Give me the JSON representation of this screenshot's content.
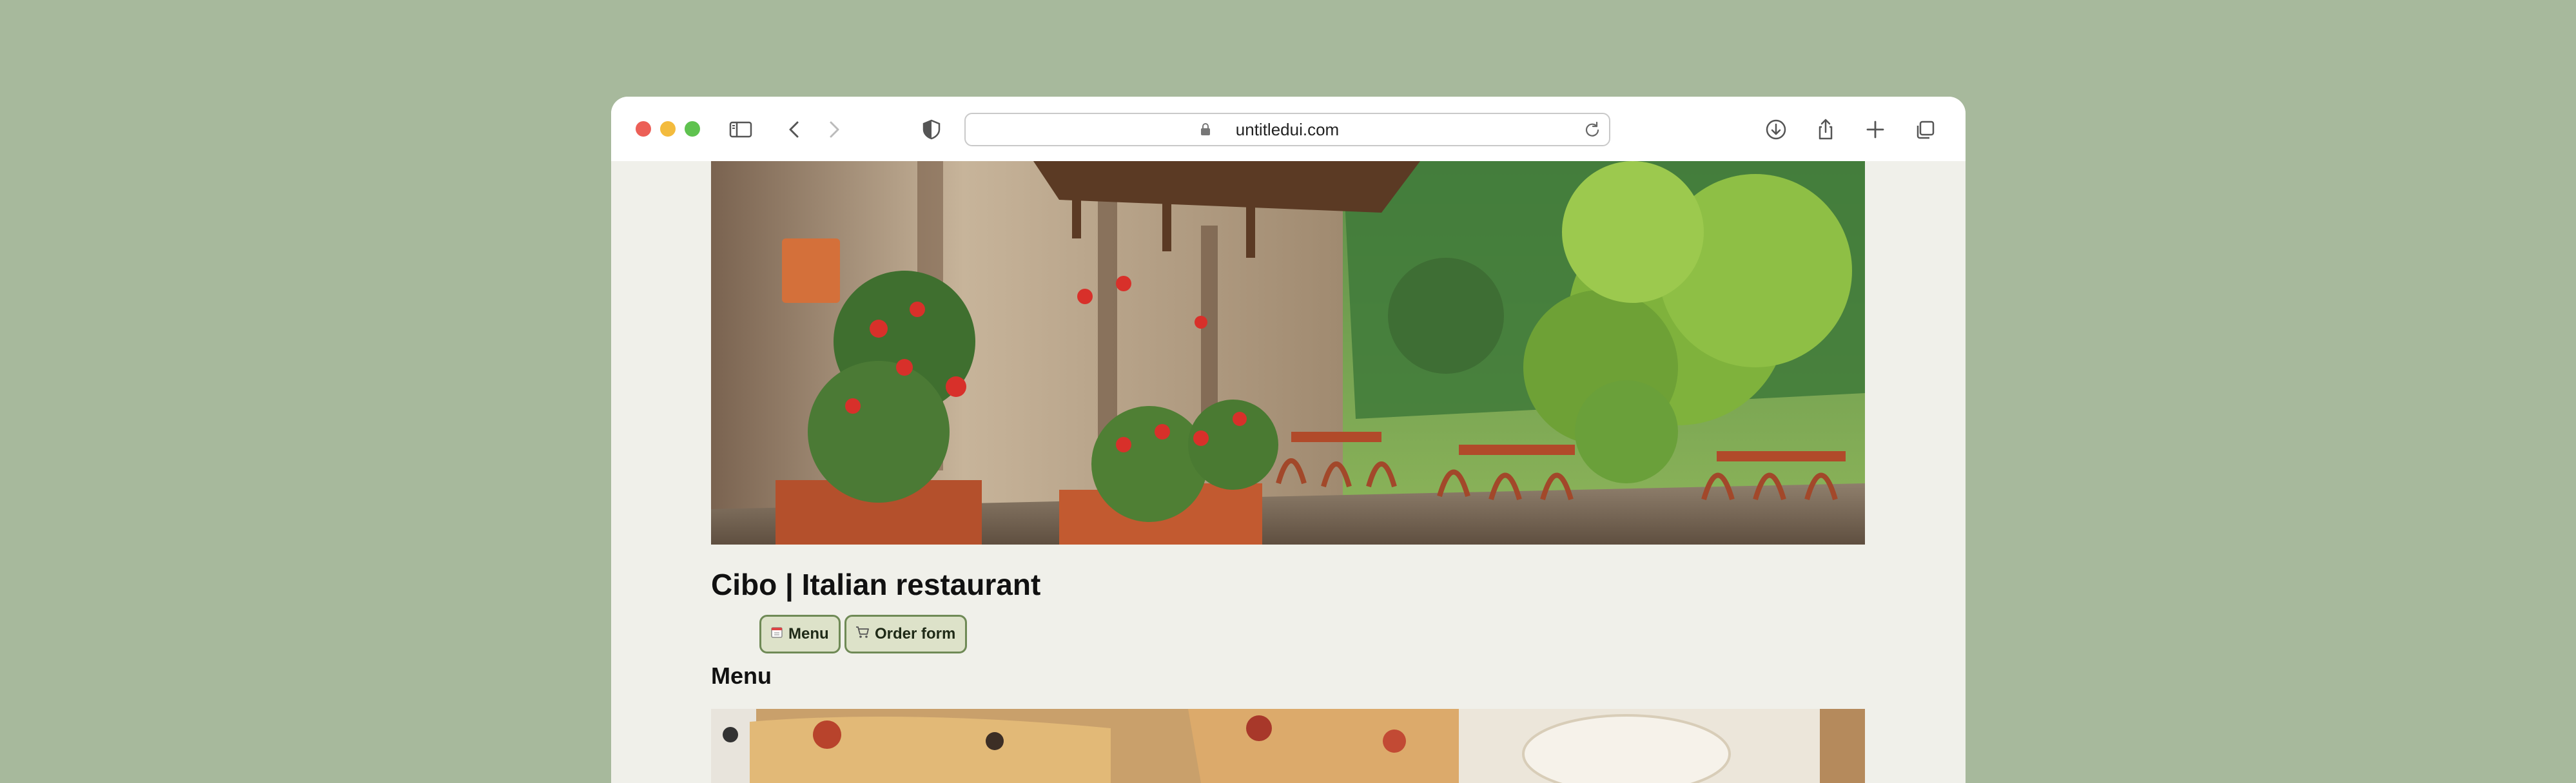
{
  "browser": {
    "url": "untitledui.com"
  },
  "page": {
    "title": "Cibo | Italian restaurant",
    "nav": [
      {
        "label": "Menu",
        "icon": "calendar-icon"
      },
      {
        "label": "Order form",
        "icon": "shopping-cart-icon"
      }
    ],
    "section_title": "Menu"
  },
  "colors": {
    "background": "#a7b99c",
    "page_bg": "#f0f0ea",
    "button_bg": "#dde2c9",
    "button_border": "#6f8a56"
  }
}
